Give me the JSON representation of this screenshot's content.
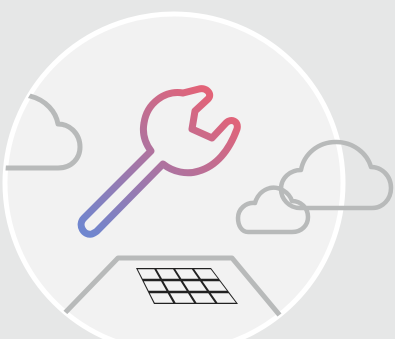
{
  "illustration": {
    "icons": {
      "badge": "circle-badge",
      "main": "wrench-icon",
      "decor": [
        "cloud-icon",
        "cloud-icon",
        "cloud-icon",
        "roof-icon",
        "solar-panel-icon"
      ]
    },
    "colors": {
      "background": "#e6e7e7",
      "badge_fill": "#f2f2f2",
      "badge_ring": "#ffffff",
      "outline_gray": "#b8baba",
      "wrench_gradient_start": "#e26378",
      "wrench_gradient_end": "#6f86cf",
      "panel_dark": "#222222",
      "panel_cells": "#f2f2f2"
    }
  }
}
